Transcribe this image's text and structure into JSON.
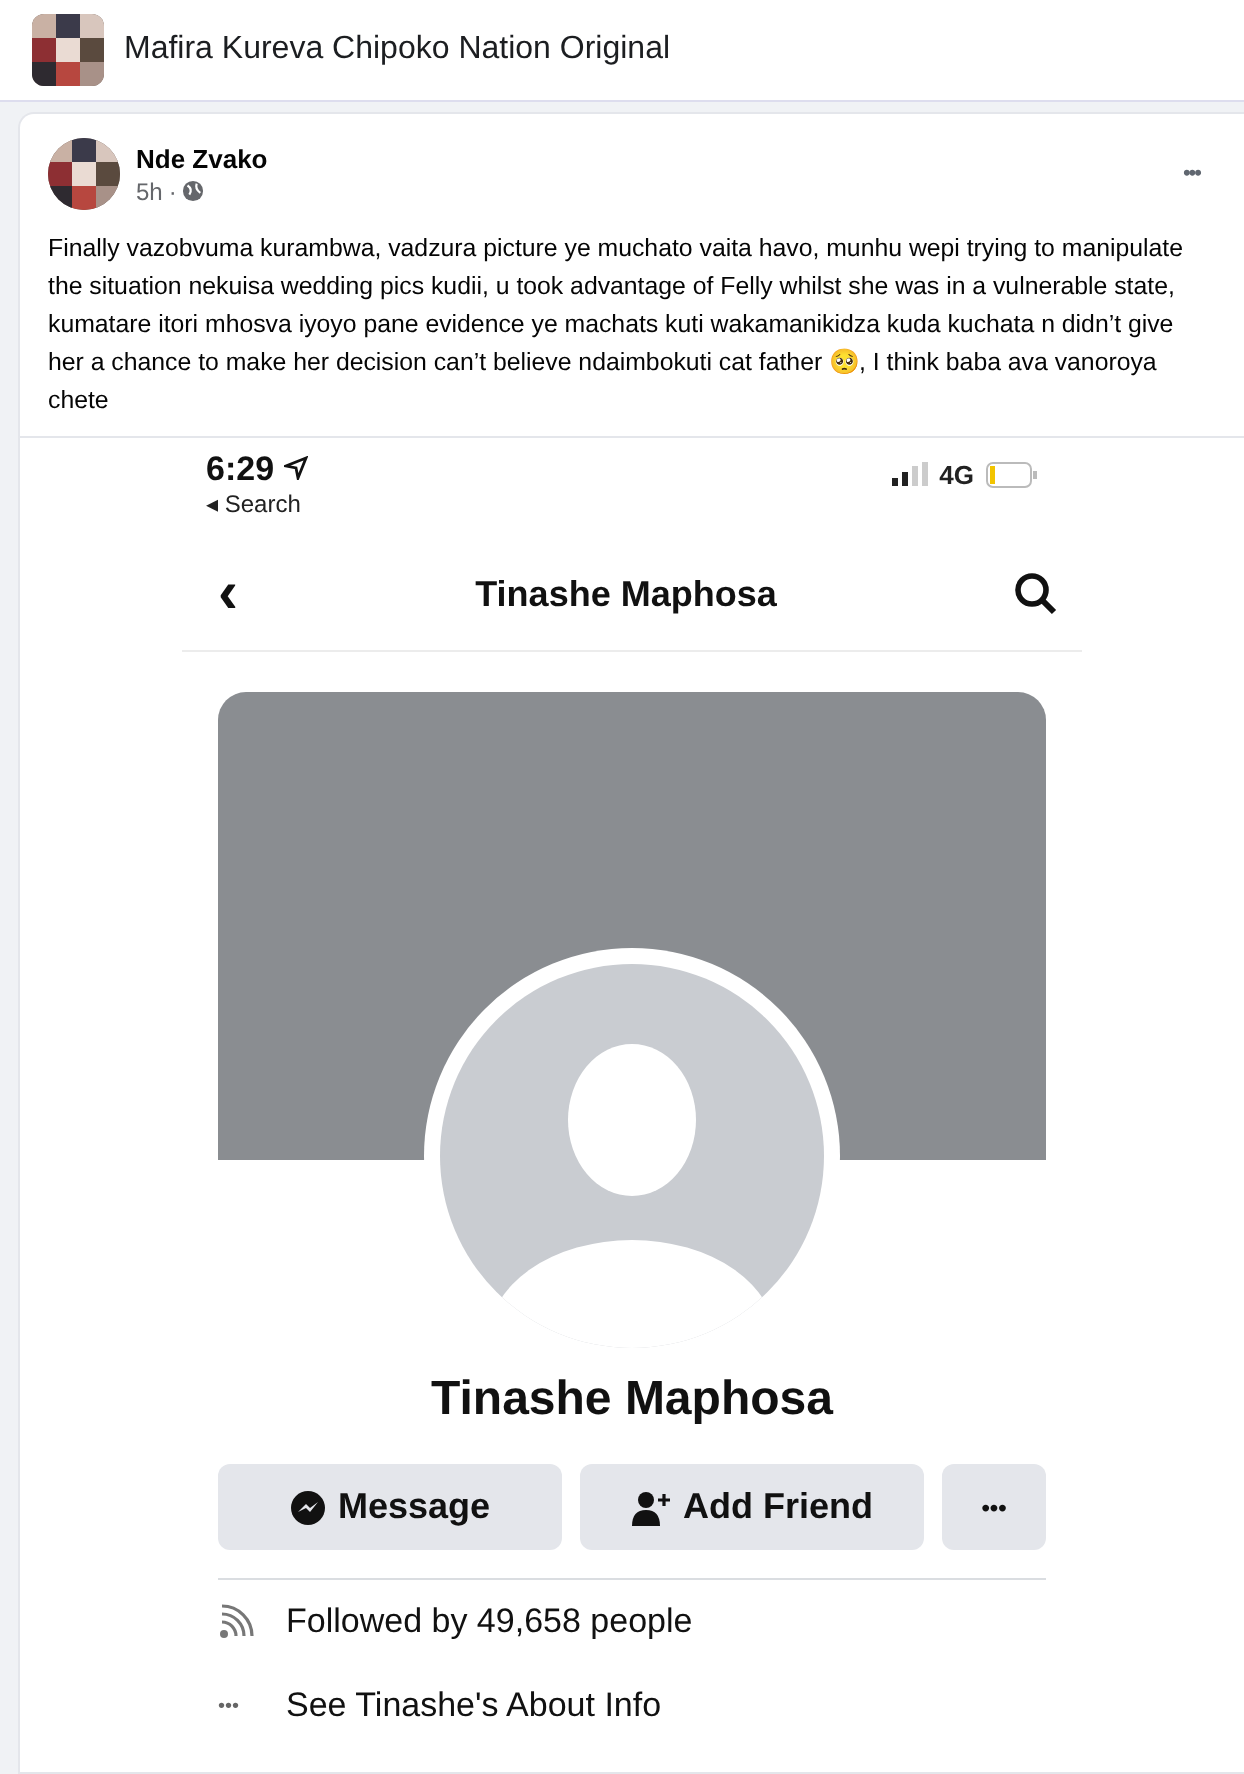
{
  "group": {
    "name": "Mafira Kureva Chipoko Nation Original"
  },
  "post": {
    "author": "Nde Zvako",
    "time": "5h",
    "separator": "·",
    "more": "•••",
    "text": "Finally vazobvuma kurambwa, vadzura picture ye muchato vaita havo, munhu wepi trying to manipulate the situation nekuisa wedding pics kudii, u took advantage of Felly whilst she was in a vulnerable state, kumatare itori mhosva iyoyo pane evidence ye machats kuti wakamanikidza kuda kuchata n didn’t give her a chance to make her decision can’t believe ndaimbokuti cat father 🥺, I think baba ava vanoroya chete"
  },
  "screenshot": {
    "status_bar": {
      "time": "6:29",
      "back_label": "◂ Search",
      "network": "4G"
    },
    "nav": {
      "back": "‹",
      "title": "Tinashe Maphosa"
    },
    "profile": {
      "name": "Tinashe Maphosa"
    },
    "buttons": [
      {
        "kind": "message",
        "label": "Message"
      },
      {
        "kind": "add-friend",
        "label": "Add Friend"
      },
      {
        "kind": "more",
        "label": "•••"
      }
    ],
    "info_rows": [
      {
        "kind": "followers",
        "icon": "",
        "text": "Followed by 49,658 people"
      },
      {
        "kind": "about",
        "icon": "•••",
        "text": "See Tinashe's About Info"
      }
    ]
  }
}
